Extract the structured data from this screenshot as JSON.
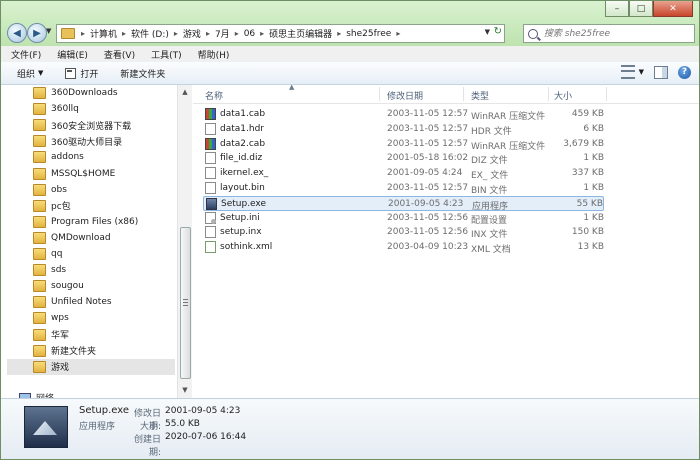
{
  "address": {
    "crumbs": [
      "计算机",
      "软件 (D:)",
      "游戏",
      "7月",
      "06",
      "硕思主页编辑器",
      "she25free"
    ],
    "search_placeholder": "搜索 she25free"
  },
  "menubar": [
    "文件(F)",
    "编辑(E)",
    "查看(V)",
    "工具(T)",
    "帮助(H)"
  ],
  "toolbar": {
    "organize": "组织",
    "open": "打开",
    "new_folder": "新建文件夹"
  },
  "nav_pane": {
    "items": [
      "360Downloads",
      "360llq",
      "360安全浏览器下载",
      "360驱动大师目录",
      "addons",
      "MSSQL$HOME",
      "obs",
      "pc包",
      "Program Files (x86)",
      "QMDownload",
      "qq",
      "sds",
      "sougou",
      "Unfiled Notes",
      "wps",
      "华军",
      "新建文件夹",
      "游戏"
    ],
    "selected": "游戏",
    "network": "网络"
  },
  "columns": {
    "name": "名称",
    "date": "修改日期",
    "type": "类型",
    "size": "大小"
  },
  "files": [
    {
      "name": "data1.cab",
      "date": "2003-11-05 12:57",
      "type": "WinRAR 压缩文件",
      "size": "459 KB",
      "icon": "rar-icon"
    },
    {
      "name": "data1.hdr",
      "date": "2003-11-05 12:57",
      "type": "HDR 文件",
      "size": "6 KB",
      "icon": "doc-icon"
    },
    {
      "name": "data2.cab",
      "date": "2003-11-05 12:57",
      "type": "WinRAR 压缩文件",
      "size": "3,679 KB",
      "icon": "rar-icon"
    },
    {
      "name": "file_id.diz",
      "date": "2001-05-18 16:02",
      "type": "DIZ 文件",
      "size": "1 KB",
      "icon": "doc-icon"
    },
    {
      "name": "ikernel.ex_",
      "date": "2001-09-05 4:24",
      "type": "EX_ 文件",
      "size": "337 KB",
      "icon": "doc-icon"
    },
    {
      "name": "layout.bin",
      "date": "2003-11-05 12:57",
      "type": "BIN 文件",
      "size": "1 KB",
      "icon": "doc-icon"
    },
    {
      "name": "Setup.exe",
      "date": "2001-09-05 4:23",
      "type": "应用程序",
      "size": "55 KB",
      "icon": "exe-icon"
    },
    {
      "name": "Setup.ini",
      "date": "2003-11-05 12:56",
      "type": "配置设置",
      "size": "1 KB",
      "icon": "ini-icon"
    },
    {
      "name": "setup.inx",
      "date": "2003-11-05 12:56",
      "type": "INX 文件",
      "size": "150 KB",
      "icon": "doc-icon"
    },
    {
      "name": "sothink.xml",
      "date": "2003-04-09 10:23",
      "type": "XML 文档",
      "size": "13 KB",
      "icon": "xml-icon"
    }
  ],
  "selected_file": "Setup.exe",
  "details": {
    "name": "Setup.exe",
    "type": "应用程序",
    "modified_label": "修改日期:",
    "modified_value": "2001-09-05 4:23",
    "size_label": "大小:",
    "size_value": "55.0 KB",
    "created_label": "创建日期:",
    "created_value": "2020-07-06 16:44"
  }
}
